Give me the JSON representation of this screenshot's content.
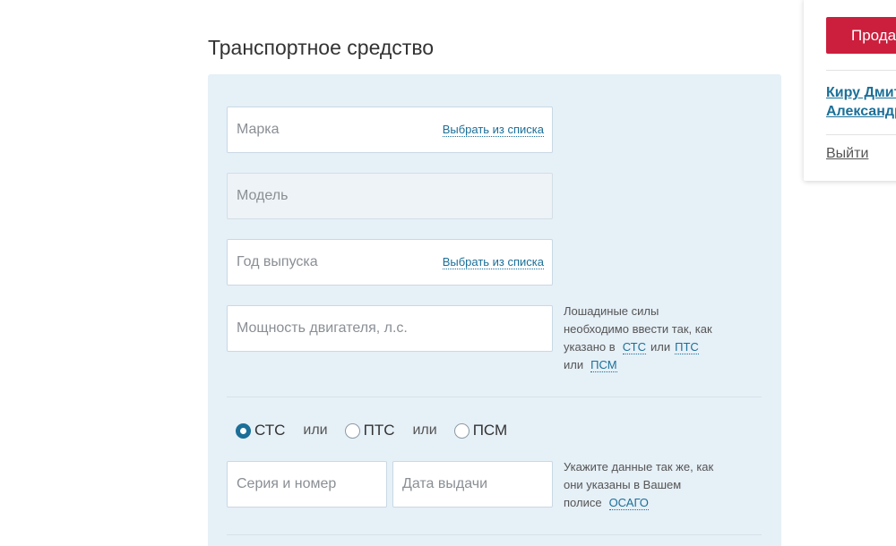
{
  "section": {
    "title": "Транспортное средство"
  },
  "fields": {
    "brand": {
      "placeholder": "Марка",
      "pick_label": "Выбрать из списка"
    },
    "model": {
      "placeholder": "Модель"
    },
    "year": {
      "placeholder": "Год выпуска",
      "pick_label": "Выбрать из списка"
    },
    "power": {
      "placeholder": "Мощность двигателя, л.с."
    },
    "series_number": {
      "placeholder": "Серия и номер"
    },
    "issue_date": {
      "placeholder": "Дата выдачи"
    }
  },
  "power_hint": {
    "line1": "Лошадиные силы",
    "line2": "необходимо ввести так, как",
    "line3_prefix": "указано в",
    "doc1": "СТС",
    "or1": "или",
    "doc2": "ПТС",
    "line4_prefix": "или",
    "doc3": "ПСМ"
  },
  "doc_type": {
    "options": [
      "СТС",
      "ПТС",
      "ПСМ"
    ],
    "selected": "СТС",
    "or_word": "или"
  },
  "doc_hint": {
    "line1": "Укажите данные так же, как",
    "line2": "они указаны в Вашем",
    "line3_prefix": "полисе",
    "link": "ОСАГО"
  },
  "account": {
    "sell_button": "Продать",
    "user_line1": "Киру Дмитрий",
    "user_line2": "Александрович",
    "logout": "Выйти"
  },
  "colors": {
    "accent": "#1b6f98",
    "button": "#cc1f3d",
    "panel": "#e6f0f7"
  }
}
